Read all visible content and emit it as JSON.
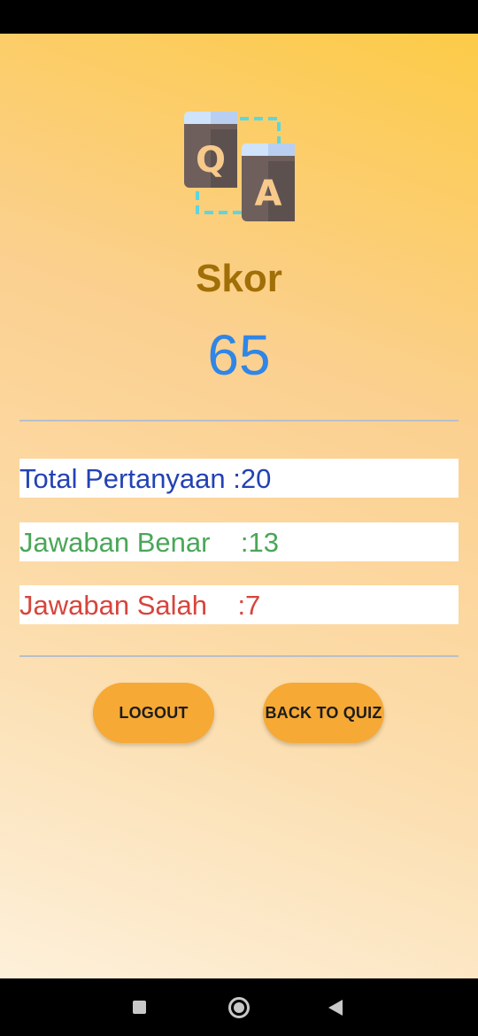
{
  "logo": {
    "icon": "qa-books-icon",
    "letter_q": "Q",
    "letter_a": "A"
  },
  "score": {
    "title": "Skor",
    "value": "65"
  },
  "stats": {
    "total": "Total Pertanyaan :20",
    "correct": "Jawaban Benar    :13",
    "wrong": "Jawaban Salah    :7"
  },
  "buttons": {
    "logout": "LOGOUT",
    "back_to_quiz": "BACK TO QUIZ"
  },
  "nav": {
    "recents": "recents-icon",
    "home": "home-icon",
    "back": "back-icon"
  },
  "colors": {
    "score_title": "#a16f07",
    "score_value": "#2f86e6",
    "total": "#2342b3",
    "correct": "#4aa658",
    "wrong": "#d6453d",
    "button": "#f6a935"
  }
}
